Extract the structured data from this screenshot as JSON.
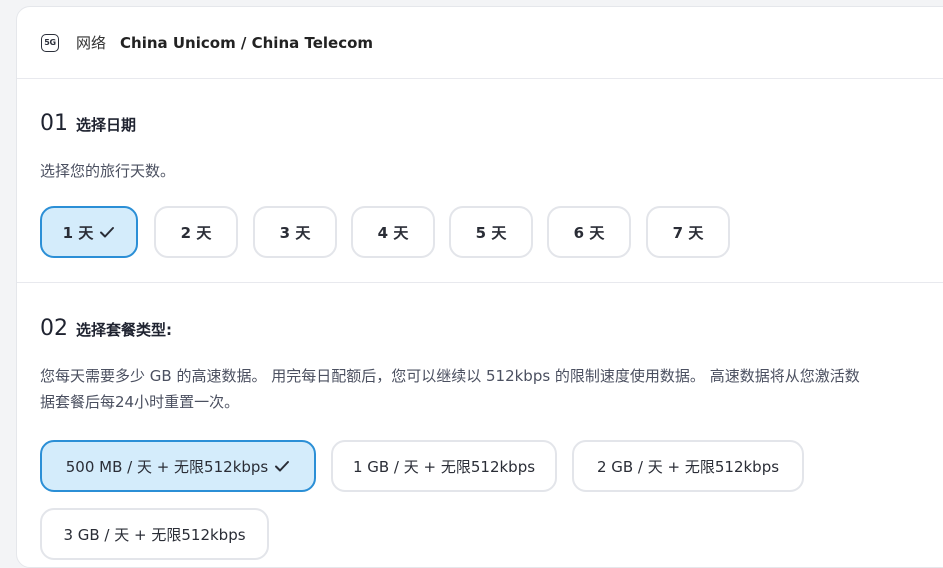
{
  "network": {
    "icon": "5g-icon",
    "icon_text": "5G",
    "label": "网络",
    "value": "China Unicom / China Telecom"
  },
  "section1": {
    "num": "01",
    "title": "选择日期",
    "desc": "选择您的旅行天数。",
    "days": [
      {
        "label": "1 天",
        "selected": true
      },
      {
        "label": "2 天",
        "selected": false
      },
      {
        "label": "3 天",
        "selected": false
      },
      {
        "label": "4 天",
        "selected": false
      },
      {
        "label": "5 天",
        "selected": false
      },
      {
        "label": "6 天",
        "selected": false
      },
      {
        "label": "7 天",
        "selected": false
      }
    ]
  },
  "section2": {
    "num": "02",
    "title": "选择套餐类型:",
    "desc_line1": "您每天需要多少 GB 的高速数据。 用完每日配额后，您可以继续以 512kbps 的限制速度使用数据。 高速数据将从您激活数",
    "desc_line2": "据套餐后每24小时重置一次。",
    "plans": [
      {
        "label": "500 MB / 天 + 无限512kbps",
        "selected": true
      },
      {
        "label": "1 GB / 天 + 无限512kbps",
        "selected": false
      },
      {
        "label": "2 GB / 天 + 无限512kbps",
        "selected": false
      },
      {
        "label": "3 GB / 天 + 无限512kbps",
        "selected": false
      }
    ]
  },
  "colors": {
    "selected_border": "#2b8fd6",
    "selected_bg": "#d4ecfb",
    "border": "#e3e5ea"
  }
}
